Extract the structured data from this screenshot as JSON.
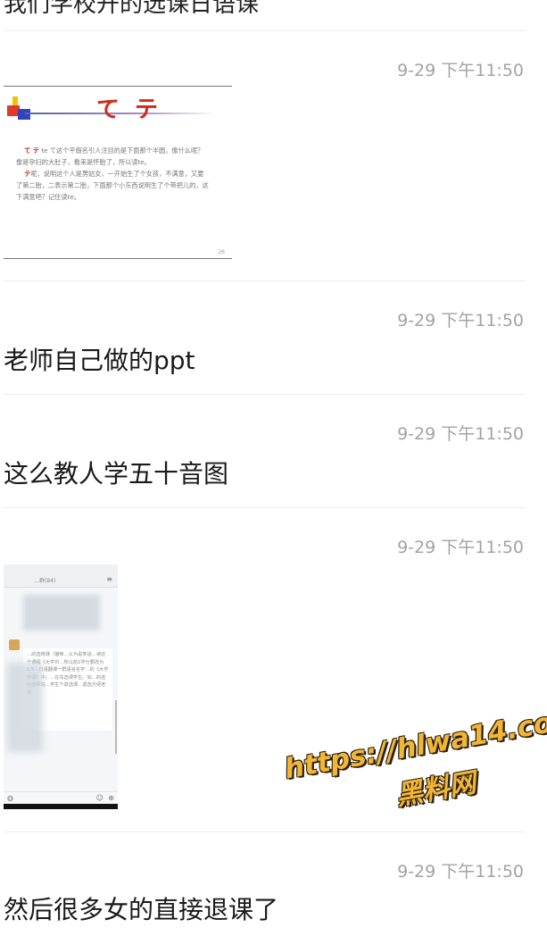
{
  "feed": {
    "partial_top_text": "我们学校开的选课日语课",
    "posts": [
      {
        "time": "9-29 下午11:50",
        "type": "image",
        "image": {
          "kana_title": "て テ",
          "line1_kana": "て テ",
          "line1": "te  て这个平假名引人注目的是下面那个半圆，像什么呢？",
          "line2": "像是孕妇的大肚子，看来是怀胎了，所以读te。",
          "line3_kana": "テ",
          "line3": "呢，说明这个人是男姑女，一开始生了个女孩，不满意，又要",
          "line4": "了第二胎，二表示第二胎，下面那个小东西说明生了个带把儿的，这",
          "line5": "下满意吧？记住读te。",
          "page_number": "26"
        }
      },
      {
        "time": "9-29 下午11:50",
        "type": "text",
        "text": "老师自己做的ppt"
      },
      {
        "time": "9-29 下午11:50",
        "type": "text",
        "text": "这么教人学五十音图"
      },
      {
        "time": "9-29 下午11:50",
        "type": "image",
        "image": {
          "appbar_title": "…群(84)",
          "bubble_text": "…的选修课（猫咪…认为是笑话…读这个课程《大学日…所以前1学分要改为1.5…日语翻课一群语言名学…的《大学日语》中，…在车选课学生。如…的选哈老师说…学生下退选课…退选方便老师"
        }
      },
      {
        "time": "9-29 下午11:50",
        "type": "text",
        "text": "然后很多女的直接退课了"
      }
    ]
  },
  "watermark": {
    "url": "https://hlwa14.com",
    "brand": "黑料网"
  },
  "colors": {
    "time_gray": "#a3a3a3",
    "divider": "#ececec",
    "kana_red": "#d42a1a",
    "watermark_gold": "#f2b634"
  }
}
